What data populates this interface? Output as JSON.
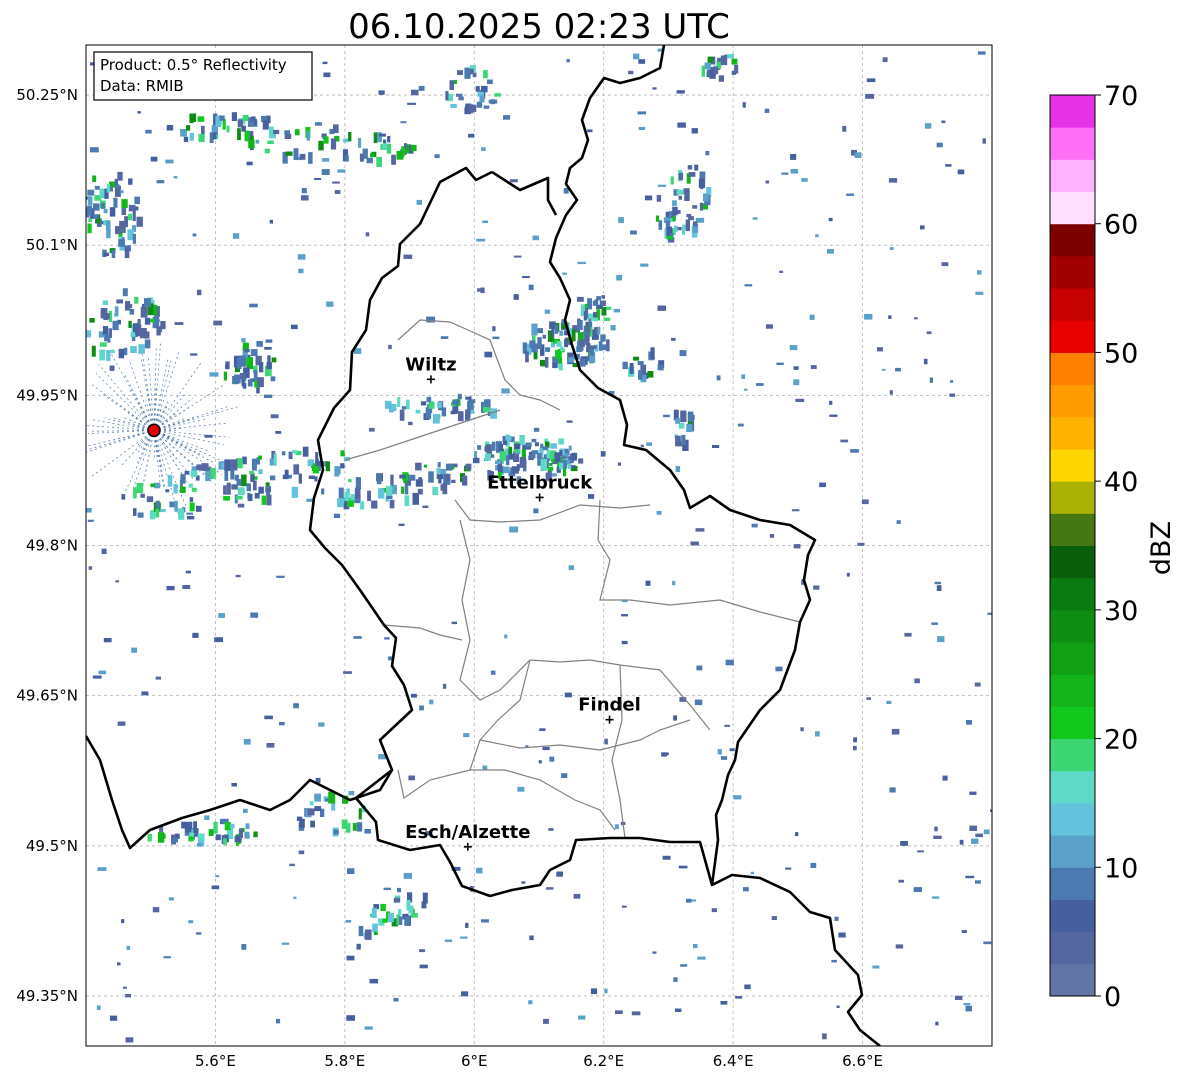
{
  "title": "06.10.2025 02:23 UTC",
  "info_box": {
    "product_line": "Product: 0.5° Reflectivity",
    "data_line": "Data: RMIB"
  },
  "map": {
    "lat_ticks": [
      "50.25°N",
      "50.1°N",
      "49.95°N",
      "49.8°N",
      "49.65°N",
      "49.5°N",
      "49.35°N"
    ],
    "lon_ticks": [
      "5.6°E",
      "5.8°E",
      "6°E",
      "6.2°E",
      "6.4°E",
      "6.6°E"
    ],
    "lat_values": [
      50.25,
      50.1,
      49.95,
      49.8,
      49.65,
      49.5,
      49.35
    ],
    "lon_values": [
      5.6,
      5.8,
      6.0,
      6.2,
      6.4,
      6.6
    ],
    "extent": {
      "lon_min": 5.4,
      "lon_max": 6.8,
      "lat_min": 49.3,
      "lat_max": 50.3
    },
    "radar_site": {
      "lon": 5.505,
      "lat": 49.915
    },
    "cities": [
      {
        "name": "Wiltz",
        "lon": 5.933,
        "lat": 49.966
      },
      {
        "name": "Ettelbruck",
        "lon": 6.101,
        "lat": 49.848
      },
      {
        "name": "Findel",
        "lon": 6.209,
        "lat": 49.626
      },
      {
        "name": "Esch/Alzette",
        "lon": 5.99,
        "lat": 49.499
      }
    ]
  },
  "colorbar": {
    "label": "dBZ",
    "ticks": [
      "0",
      "10",
      "20",
      "30",
      "40",
      "50",
      "60",
      "70"
    ],
    "min": 0,
    "max": 70,
    "step": 2.5,
    "colors": [
      "#6174a3",
      "#5566a0",
      "#465f9f",
      "#4c7ab0",
      "#5aa0c8",
      "#65c2dc",
      "#5fd8c8",
      "#3dd675",
      "#12c81c",
      "#13b31b",
      "#119f16",
      "#0e8c13",
      "#0b7a10",
      "#085e0a",
      "#457812",
      "#aab205",
      "#ffd700",
      "#ffb300",
      "#ff9c00",
      "#ff7f00",
      "#e80000",
      "#c60000",
      "#a20000",
      "#7d0000",
      "#ffe0ff",
      "#ffb2ff",
      "#ff70f7",
      "#e632e6"
    ]
  }
}
